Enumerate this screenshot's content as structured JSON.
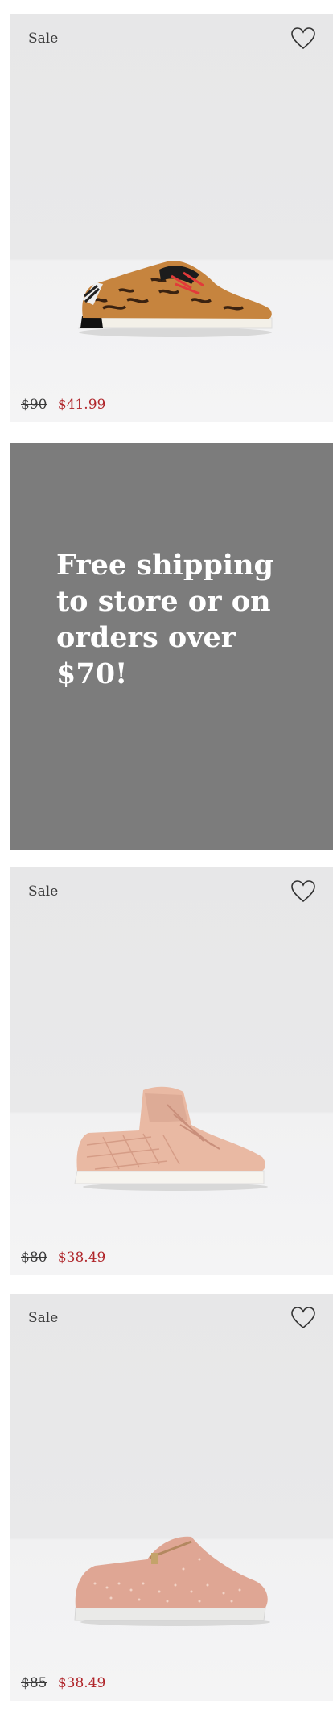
{
  "products": [
    {
      "badge": "Sale",
      "old_price": "$90",
      "new_price": "$41.99",
      "name_icon": "leopard-print-sneaker"
    },
    {
      "badge": "Sale",
      "old_price": "$80",
      "new_price": "$38.49",
      "name_icon": "pink-quilted-high-top-sneaker"
    },
    {
      "badge": "Sale",
      "old_price": "$85",
      "new_price": "$38.49",
      "name_icon": "pink-embellished-zip-sneaker"
    }
  ],
  "promo": {
    "text": "Free shipping to store or on orders over $70!"
  },
  "colors": {
    "sale_price": "#b0252a",
    "promo_bg": "#7c7c7c",
    "card_bg": "#e8e8e9"
  },
  "icons": {
    "favorite": "heart-outline-icon"
  }
}
